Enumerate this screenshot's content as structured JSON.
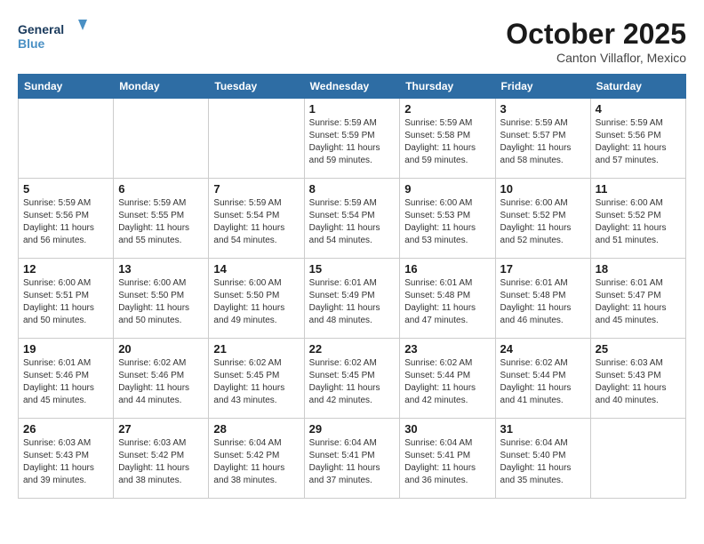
{
  "header": {
    "logo_line1": "General",
    "logo_line2": "Blue",
    "month": "October 2025",
    "location": "Canton Villaflor, Mexico"
  },
  "weekdays": [
    "Sunday",
    "Monday",
    "Tuesday",
    "Wednesday",
    "Thursday",
    "Friday",
    "Saturday"
  ],
  "weeks": [
    [
      {
        "day": "",
        "info": ""
      },
      {
        "day": "",
        "info": ""
      },
      {
        "day": "",
        "info": ""
      },
      {
        "day": "1",
        "info": "Sunrise: 5:59 AM\nSunset: 5:59 PM\nDaylight: 11 hours\nand 59 minutes."
      },
      {
        "day": "2",
        "info": "Sunrise: 5:59 AM\nSunset: 5:58 PM\nDaylight: 11 hours\nand 59 minutes."
      },
      {
        "day": "3",
        "info": "Sunrise: 5:59 AM\nSunset: 5:57 PM\nDaylight: 11 hours\nand 58 minutes."
      },
      {
        "day": "4",
        "info": "Sunrise: 5:59 AM\nSunset: 5:56 PM\nDaylight: 11 hours\nand 57 minutes."
      }
    ],
    [
      {
        "day": "5",
        "info": "Sunrise: 5:59 AM\nSunset: 5:56 PM\nDaylight: 11 hours\nand 56 minutes."
      },
      {
        "day": "6",
        "info": "Sunrise: 5:59 AM\nSunset: 5:55 PM\nDaylight: 11 hours\nand 55 minutes."
      },
      {
        "day": "7",
        "info": "Sunrise: 5:59 AM\nSunset: 5:54 PM\nDaylight: 11 hours\nand 54 minutes."
      },
      {
        "day": "8",
        "info": "Sunrise: 5:59 AM\nSunset: 5:54 PM\nDaylight: 11 hours\nand 54 minutes."
      },
      {
        "day": "9",
        "info": "Sunrise: 6:00 AM\nSunset: 5:53 PM\nDaylight: 11 hours\nand 53 minutes."
      },
      {
        "day": "10",
        "info": "Sunrise: 6:00 AM\nSunset: 5:52 PM\nDaylight: 11 hours\nand 52 minutes."
      },
      {
        "day": "11",
        "info": "Sunrise: 6:00 AM\nSunset: 5:52 PM\nDaylight: 11 hours\nand 51 minutes."
      }
    ],
    [
      {
        "day": "12",
        "info": "Sunrise: 6:00 AM\nSunset: 5:51 PM\nDaylight: 11 hours\nand 50 minutes."
      },
      {
        "day": "13",
        "info": "Sunrise: 6:00 AM\nSunset: 5:50 PM\nDaylight: 11 hours\nand 50 minutes."
      },
      {
        "day": "14",
        "info": "Sunrise: 6:00 AM\nSunset: 5:50 PM\nDaylight: 11 hours\nand 49 minutes."
      },
      {
        "day": "15",
        "info": "Sunrise: 6:01 AM\nSunset: 5:49 PM\nDaylight: 11 hours\nand 48 minutes."
      },
      {
        "day": "16",
        "info": "Sunrise: 6:01 AM\nSunset: 5:48 PM\nDaylight: 11 hours\nand 47 minutes."
      },
      {
        "day": "17",
        "info": "Sunrise: 6:01 AM\nSunset: 5:48 PM\nDaylight: 11 hours\nand 46 minutes."
      },
      {
        "day": "18",
        "info": "Sunrise: 6:01 AM\nSunset: 5:47 PM\nDaylight: 11 hours\nand 45 minutes."
      }
    ],
    [
      {
        "day": "19",
        "info": "Sunrise: 6:01 AM\nSunset: 5:46 PM\nDaylight: 11 hours\nand 45 minutes."
      },
      {
        "day": "20",
        "info": "Sunrise: 6:02 AM\nSunset: 5:46 PM\nDaylight: 11 hours\nand 44 minutes."
      },
      {
        "day": "21",
        "info": "Sunrise: 6:02 AM\nSunset: 5:45 PM\nDaylight: 11 hours\nand 43 minutes."
      },
      {
        "day": "22",
        "info": "Sunrise: 6:02 AM\nSunset: 5:45 PM\nDaylight: 11 hours\nand 42 minutes."
      },
      {
        "day": "23",
        "info": "Sunrise: 6:02 AM\nSunset: 5:44 PM\nDaylight: 11 hours\nand 42 minutes."
      },
      {
        "day": "24",
        "info": "Sunrise: 6:02 AM\nSunset: 5:44 PM\nDaylight: 11 hours\nand 41 minutes."
      },
      {
        "day": "25",
        "info": "Sunrise: 6:03 AM\nSunset: 5:43 PM\nDaylight: 11 hours\nand 40 minutes."
      }
    ],
    [
      {
        "day": "26",
        "info": "Sunrise: 6:03 AM\nSunset: 5:43 PM\nDaylight: 11 hours\nand 39 minutes."
      },
      {
        "day": "27",
        "info": "Sunrise: 6:03 AM\nSunset: 5:42 PM\nDaylight: 11 hours\nand 38 minutes."
      },
      {
        "day": "28",
        "info": "Sunrise: 6:04 AM\nSunset: 5:42 PM\nDaylight: 11 hours\nand 38 minutes."
      },
      {
        "day": "29",
        "info": "Sunrise: 6:04 AM\nSunset: 5:41 PM\nDaylight: 11 hours\nand 37 minutes."
      },
      {
        "day": "30",
        "info": "Sunrise: 6:04 AM\nSunset: 5:41 PM\nDaylight: 11 hours\nand 36 minutes."
      },
      {
        "day": "31",
        "info": "Sunrise: 6:04 AM\nSunset: 5:40 PM\nDaylight: 11 hours\nand 35 minutes."
      },
      {
        "day": "",
        "info": ""
      }
    ]
  ]
}
